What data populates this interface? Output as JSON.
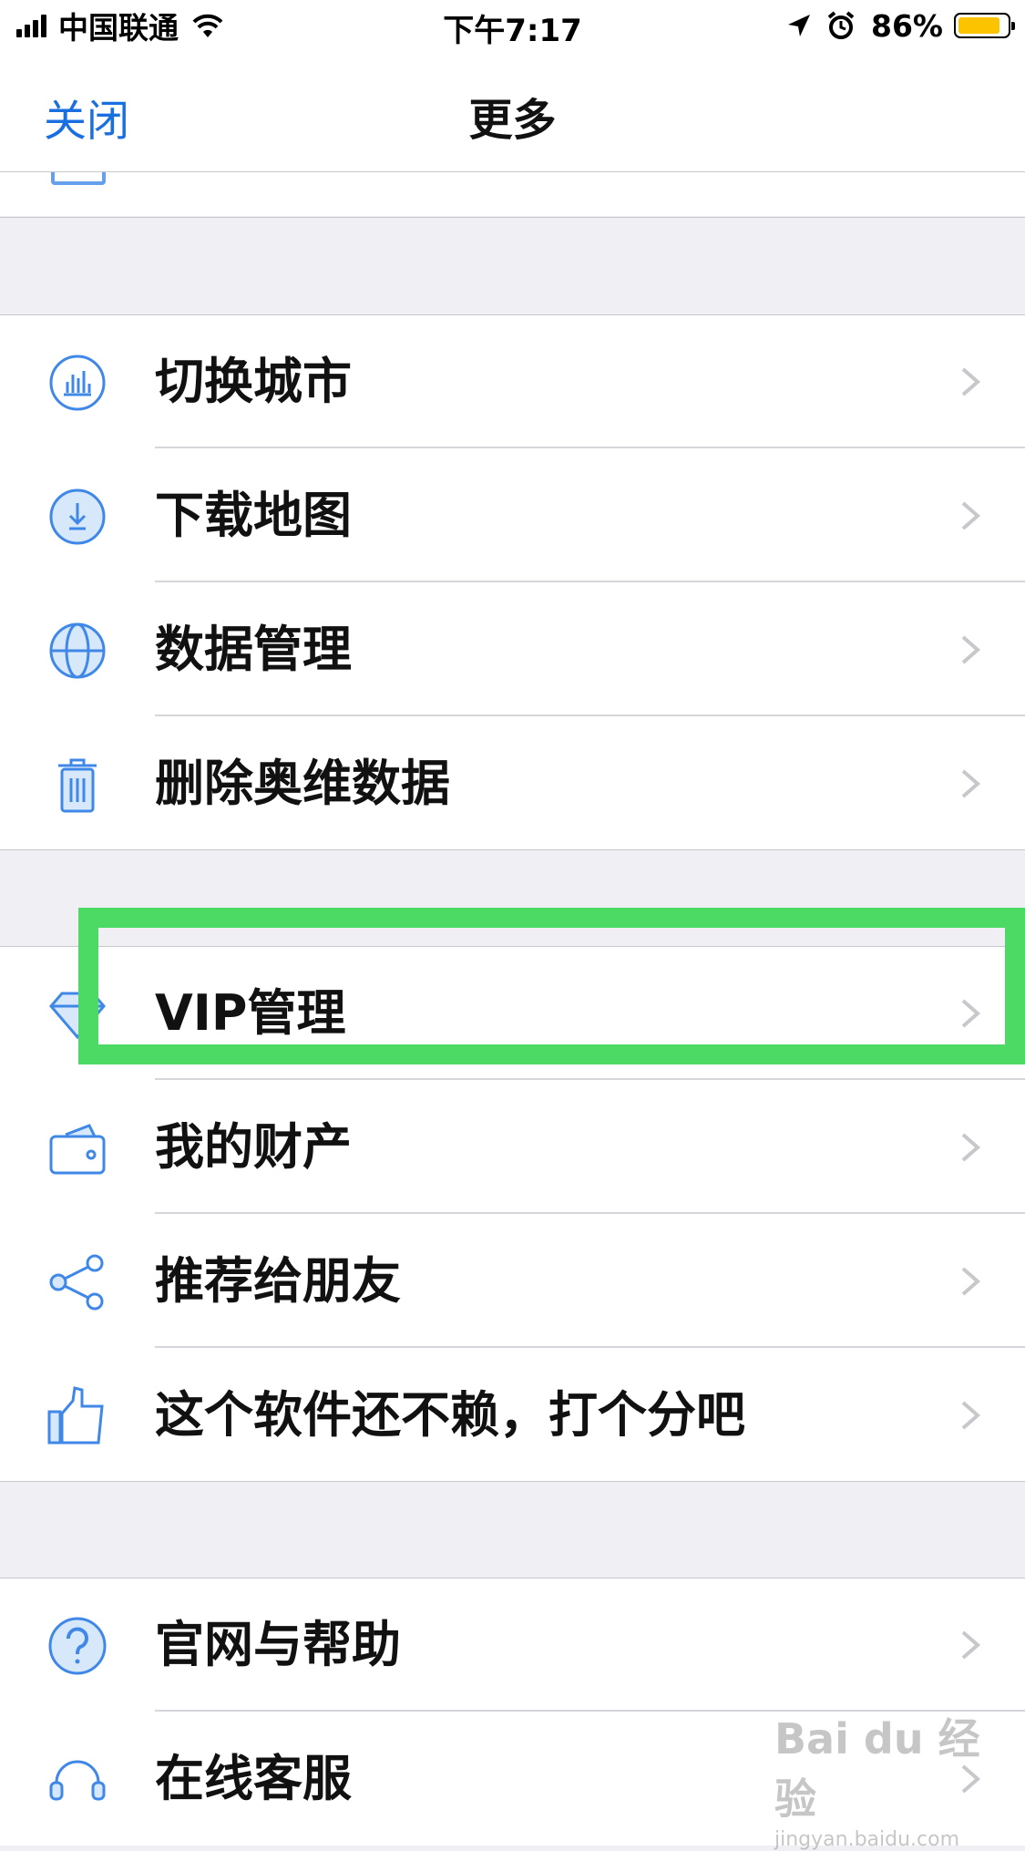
{
  "status_bar": {
    "carrier": "中国联通",
    "time": "下午7:17",
    "battery": "86%",
    "battery_level": 0.86
  },
  "nav": {
    "close_label": "关闭",
    "title": "更多"
  },
  "groups": [
    {
      "items": [
        {
          "label": "切换城市",
          "icon": "city-chart-icon"
        },
        {
          "label": "下载地图",
          "icon": "download-icon"
        },
        {
          "label": "数据管理",
          "icon": "globe-icon"
        },
        {
          "label": "删除奥维数据",
          "icon": "trash-icon"
        }
      ]
    },
    {
      "items": [
        {
          "label": "VIP管理",
          "icon": "diamond-icon"
        },
        {
          "label": "我的财产",
          "icon": "wallet-icon"
        },
        {
          "label": "推荐给朋友",
          "icon": "share-icon"
        },
        {
          "label": "这个软件还不赖，打个分吧",
          "icon": "thumbs-up-icon"
        }
      ]
    },
    {
      "items": [
        {
          "label": "官网与帮助",
          "icon": "help-icon"
        },
        {
          "label": "在线客服",
          "icon": "headset-icon"
        }
      ]
    }
  ],
  "watermark": {
    "main": "Bai du 经验",
    "sub": "jingyan.baidu.com"
  },
  "colors": {
    "accent": "#1a6fe0",
    "icon_blue": "#3f88e8",
    "highlight": "#4cd964",
    "background": "#efeff4"
  }
}
